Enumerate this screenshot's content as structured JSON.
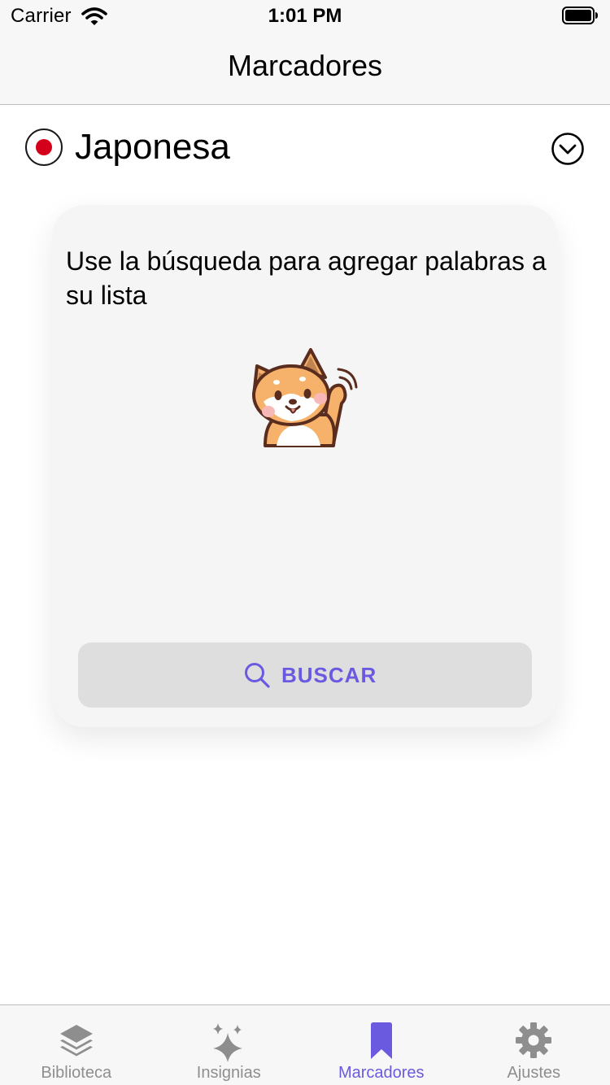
{
  "status_bar": {
    "carrier": "Carrier",
    "time": "1:01 PM"
  },
  "nav": {
    "title": "Marcadores"
  },
  "language": {
    "name": "Japonesa",
    "flag_icon": "japan-flag-icon"
  },
  "card": {
    "message": "Use la búsqueda para agregar palabras a su lista",
    "search_button_label": "BUSCAR"
  },
  "tabs": [
    {
      "label": "Biblioteca",
      "icon": "layers-icon",
      "active": false
    },
    {
      "label": "Insignias",
      "icon": "sparkles-icon",
      "active": false
    },
    {
      "label": "Marcadores",
      "icon": "bookmark-icon",
      "active": true
    },
    {
      "label": "Ajustes",
      "icon": "gear-icon",
      "active": false
    }
  ],
  "colors": {
    "accent": "#6a5ae0",
    "inactive": "#8e8e8e",
    "flag_red": "#d4001b"
  }
}
